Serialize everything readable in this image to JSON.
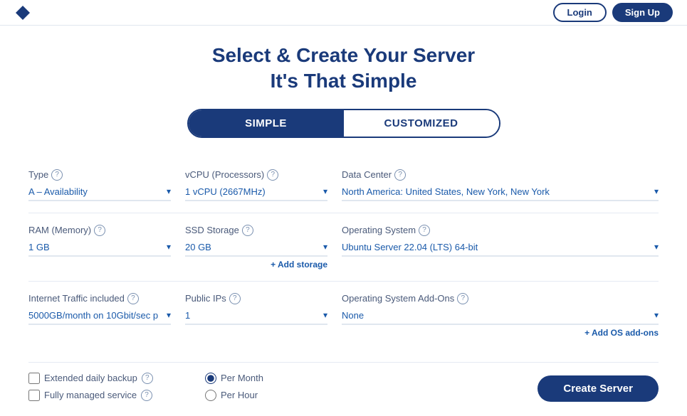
{
  "topbar": {
    "login_label": "Login",
    "signup_label": "Sign Up"
  },
  "page": {
    "title_line1": "Select & Create Your Server",
    "title_line2": "It's That Simple"
  },
  "tabs": {
    "simple_label": "SIMPLE",
    "customized_label": "CUSTOMIZED"
  },
  "fields": {
    "type": {
      "label": "Type",
      "value": "A – Availability"
    },
    "vcpu": {
      "label": "vCPU (Processors)",
      "value": "1 vCPU (2667MHz)"
    },
    "data_center": {
      "label": "Data Center",
      "value": "North America: United States, New York, New York"
    },
    "ram": {
      "label": "RAM (Memory)",
      "value": "1 GB"
    },
    "ssd": {
      "label": "SSD Storage",
      "value": "20 GB"
    },
    "add_storage": {
      "label": "+ Add storage"
    },
    "os": {
      "label": "Operating System",
      "value": "Ubuntu Server 22.04 (LTS) 64-bit"
    },
    "traffic": {
      "label": "Internet Traffic included",
      "value": "5000GB/month on 10Gbit/sec p"
    },
    "public_ips": {
      "label": "Public IPs",
      "value": "1"
    },
    "os_addons": {
      "label": "Operating System Add-Ons",
      "value": "None"
    },
    "add_os": {
      "label": "+ Add OS add-ons"
    }
  },
  "bottom": {
    "extended_backup_label": "Extended daily backup",
    "managed_service_label": "Fully managed service",
    "per_month_label": "Per Month",
    "per_hour_label": "Per Hour",
    "create_label": "Create Server"
  },
  "help_icon_symbol": "?",
  "chevron_symbol": "▾"
}
